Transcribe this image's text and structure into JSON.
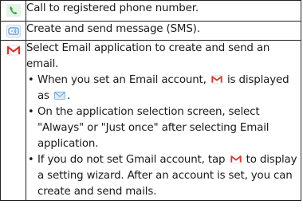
{
  "rows": [
    {
      "icon": "phone-icon",
      "text": "Call to registered phone number."
    },
    {
      "icon": "sms-message-icon",
      "text": "Create and send message (SMS)."
    },
    {
      "icon": "gmail-icon",
      "text": "Select Email application to create and send an email.",
      "bullets": [
        {
          "before": "When you set an Email account,",
          "icon": "gmail-icon",
          "middle": "is displayed as",
          "icon2": "email-envelope-icon",
          "after": "."
        },
        {
          "text": "On the application selection screen, select \"Always\" or \"Just once\" after selecting Email application."
        },
        {
          "before": "If you do not set Gmail account, tap",
          "icon": "gmail-icon",
          "after": "to display a setting wizard. After an account is set, you can create and send mails."
        }
      ]
    }
  ],
  "colors": {
    "phone": "#3aa84a",
    "sms": "#4a90d9",
    "gmail_red": "#d9382b",
    "envelope": "#6ba3d6",
    "border": "#222222"
  }
}
